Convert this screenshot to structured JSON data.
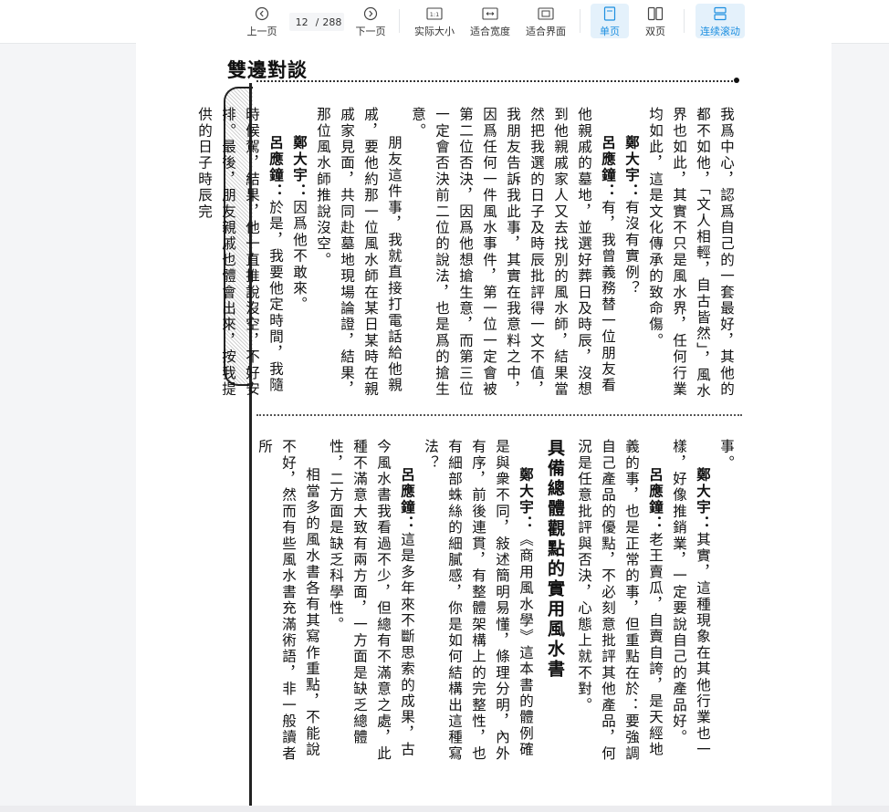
{
  "toolbar": {
    "prev_label": "上一页",
    "next_label": "下一页",
    "current_page": "12",
    "total_pages": "288",
    "actual_size_label": "实际大小",
    "fit_width_label": "适合宽度",
    "fit_page_label": "适合界面",
    "single_page_label": "单页",
    "double_page_label": "双页",
    "continuous_label": "连续滚动",
    "accent_color": "#1d8fe0"
  },
  "page": {
    "running_head": "雙邊對談",
    "upper": [
      {
        "text": "我爲中心，認爲自己的一套最好，其他的都不如他，「文人相輕，自古皆然」，風水界也如此，其實不只是風水界，任何行業均如此，這是文化傳承的致命傷。"
      },
      {
        "speaker": "鄭大宇：",
        "text": "有沒有實例？"
      },
      {
        "speaker": "呂應鐘：",
        "text": "有，我曾義務替一位朋友看他親戚的墓地，並選好葬日及時辰，沒想到他親戚家人又去找別的風水師，結果當然把我選的日子及時辰批評得一文不值，我朋友告訴我此事，其實在我意料之中，因爲任何一件風水事件，第一位一定會被第二位否決，因爲他想搶生意，而第三位一定會否決前二位的說法，也是爲的搶生意。"
      },
      {
        "text": "朋友這件事，我就直接打電話給他親戚，要他約那一位風水師在某日某時在親戚家見面，共同赴墓地現場論證，結果，那位風水師推說沒空。"
      },
      {
        "speaker": "鄭大宇：",
        "text": "因爲他不敢來。"
      },
      {
        "speaker": "呂應鐘：",
        "text": "於是，我要他定時間，我隨時候駕，結果，他一直推說沒空，不好安排。最後，朋友親戚也體會出來，按我提供的日子時辰完"
      }
    ],
    "lower": [
      {
        "text": "事。"
      },
      {
        "speaker": "鄭大宇：",
        "text": "其實，這種現象在其他行業也一樣，好像推銷業，一定要說自己的產品好。"
      },
      {
        "speaker": "呂應鐘：",
        "text": "老王賣瓜，自賣自誇，是天經地義的事，也是正常的事，但重點在於：要強調自己產品的優點，不必刻意批評其他產品，何況是任意批評與否決，心態上就不對。"
      },
      {
        "heading": "具備總體觀點的實用風水書"
      },
      {
        "speaker": "鄭大宇：",
        "text": "《商用風水學》這本書的體例確是與衆不同，敍述簡明易懂，條理分明，內外有序，前後連貫，有整體架構上的完整性，也有細部蛛絲的細膩感，你是如何結構出這種寫法？"
      },
      {
        "speaker": "呂應鐘：",
        "text": "這是多年來不斷思索的成果，古今風水書我看過不少，但總有不滿意之處，此種不滿意大致有兩方面，一方面是缺乏總體性，二方面是缺乏科學性。"
      },
      {
        "text": "相當多的風水書各有其寫作重點，不能說不好，然而有些風水書充滿術語，非一般讀者所"
      }
    ]
  }
}
